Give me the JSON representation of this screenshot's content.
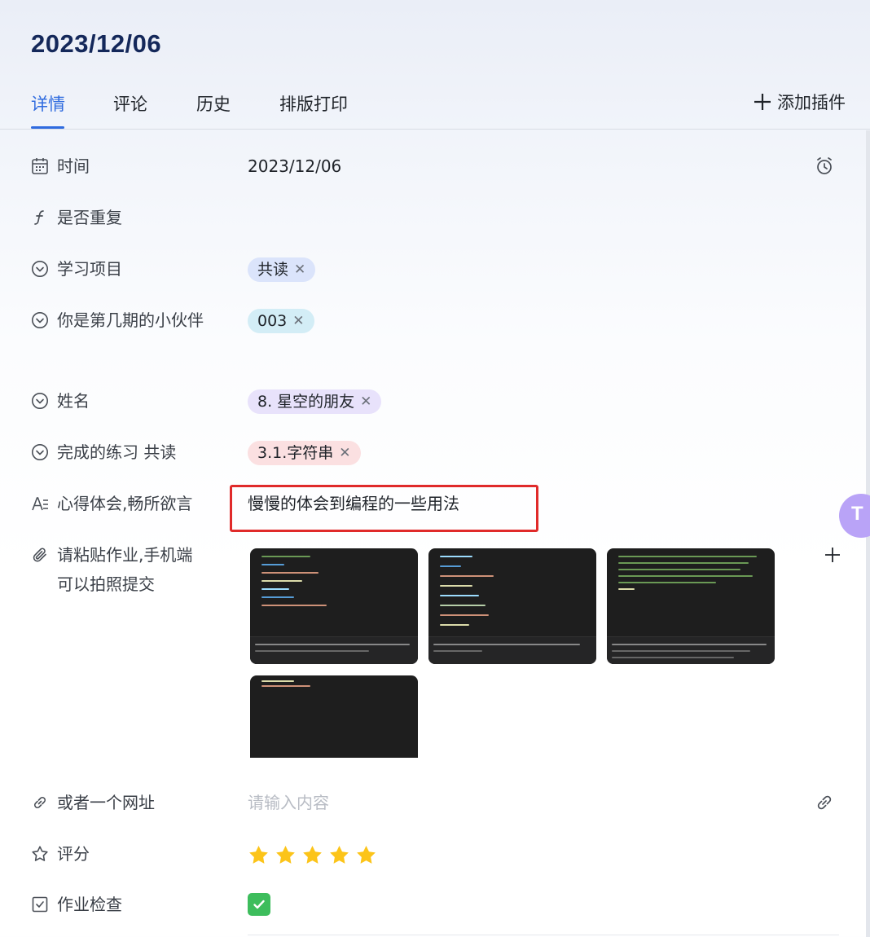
{
  "header": {
    "title": "2023/12/06"
  },
  "tabs": [
    {
      "label": "详情",
      "active": true
    },
    {
      "label": "评论",
      "active": false
    },
    {
      "label": "历史",
      "active": false
    },
    {
      "label": "排版打印",
      "active": false
    }
  ],
  "add_plugin": {
    "label": "添加插件",
    "icon": "plus-icon"
  },
  "fields": {
    "time": {
      "label": "时间",
      "value": "2023/12/06",
      "icon": "calendar-icon",
      "action_icon": "alarm-clock-icon"
    },
    "repeat": {
      "label": "是否重复",
      "icon": "formula-icon"
    },
    "project": {
      "label": "学习项目",
      "tags": [
        "共读"
      ],
      "icon": "chevron-circle-icon"
    },
    "period": {
      "label": "你是第几期的小伙伴",
      "tags": [
        "003"
      ],
      "icon": "chevron-circle-icon"
    },
    "name": {
      "label": "姓名",
      "tags": [
        "8. 星空的朋友"
      ],
      "icon": "chevron-circle-icon"
    },
    "exercise": {
      "label": "完成的练习 共读",
      "tags": [
        "3.1.字符串"
      ],
      "icon": "chevron-circle-icon"
    },
    "reflection": {
      "label": "心得体会,畅所欲言",
      "value": "慢慢的体会到编程的一些用法",
      "icon": "text-icon"
    },
    "homework": {
      "label": "请粘贴作业,手机端可以拍照提交",
      "icon": "paperclip-icon",
      "attachment_count": 4,
      "add_icon": "plus-icon"
    },
    "url": {
      "label": "或者一个网址",
      "placeholder": "请输入内容",
      "icon": "link-icon"
    },
    "rating": {
      "label": "评分",
      "value": 5,
      "max": 5,
      "icon": "star-outline-icon"
    },
    "check": {
      "label": "作业检查",
      "checked": true,
      "icon": "checkbox-icon"
    }
  },
  "colors": {
    "accent": "#2f6bdf",
    "title": "#14285a",
    "star": "#fcc419",
    "checkbox": "#3dbd5c",
    "highlight_box": "#e02a2a"
  }
}
